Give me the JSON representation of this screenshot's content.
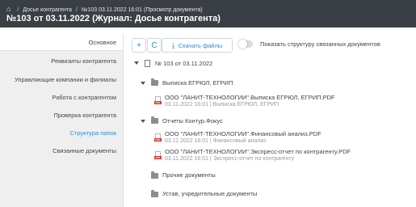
{
  "header": {
    "breadcrumb_home_icon": "home-icon",
    "breadcrumb_1": "Досье контрагента",
    "breadcrumb_2": "№103 03.11.2022 16:01  (Просмотр документа)",
    "title": "№103 от 03.11.2022 (Журнал: Досье контрагента)"
  },
  "sidebar": {
    "items": [
      {
        "label": "Основное"
      },
      {
        "label": "Реквизиты контрагента"
      },
      {
        "label": "Управляющие компании и филиалы"
      },
      {
        "label": "Работа с контрагентом"
      },
      {
        "label": "Проверка контрагента"
      },
      {
        "label": "Структура папок"
      },
      {
        "label": "Связанные документы"
      }
    ],
    "active_index": 5
  },
  "toolbar": {
    "add_label": "+",
    "refresh_label": "C",
    "download_label": "Скачать файлы",
    "toggle_label": "Показать структуру связанных документов"
  },
  "tree": {
    "root": "№ 103 от 03.11.2022",
    "folder1": "Выписка ЕГРЮЛ, ЕГРИП",
    "file1_name": "ООО \"ЛАНИТ-ТЕХНОЛОГИИ\".Выписка ЕГРЮЛ, ЕГРИП.PDF",
    "file1_meta": "03.11.2022 16:01  |  Выписка ЕГРЮЛ, ЕГРИП",
    "folder2": "Отчеты Контур.Фокус",
    "file2_name": "ООО \"ЛАНИТ-ТЕХНОЛОГИИ\".Финансовый анализ.PDF",
    "file2_meta": "03.11.2022 16:01  |  Финансовый анализ",
    "file3_name": "ООО \"ЛАНИТ-ТЕХНОЛОГИИ\".Экспресс-отчет по контрагенту.PDF",
    "file3_meta": "03.11.2022 16:01  |  Экспресс-отчет по контрагенту",
    "folder3": "Прочие документы",
    "folder4": "Устав, учредительные документы"
  },
  "colors": {
    "accent": "#2b8fd6",
    "header_bg": "#3a3f46",
    "pdf_red": "#d9342b"
  }
}
